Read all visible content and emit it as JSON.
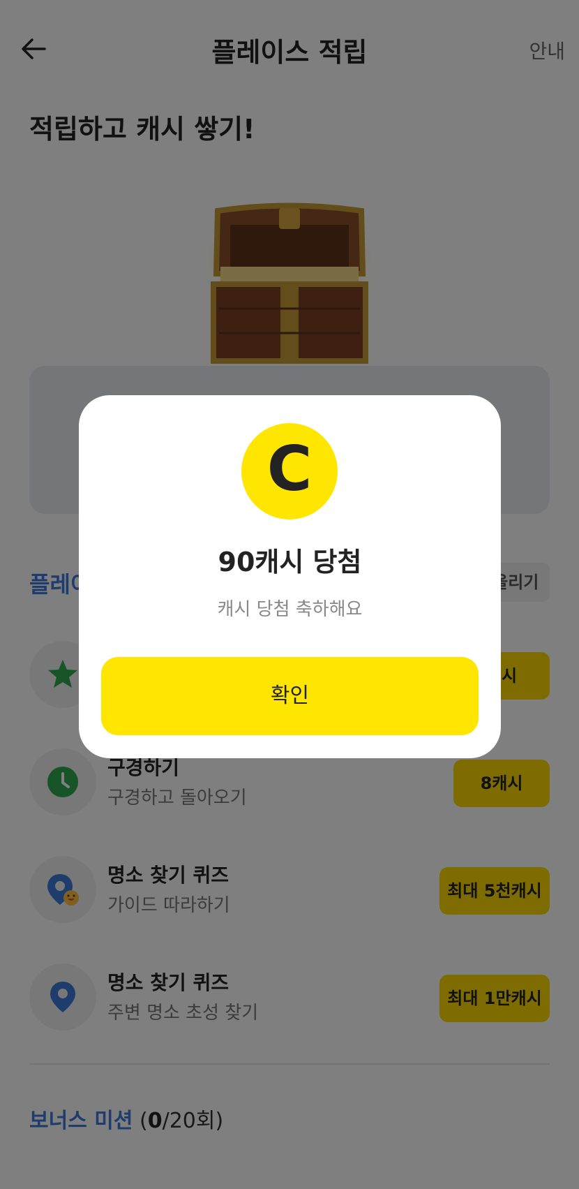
{
  "header": {
    "title": "플레이스 적립",
    "guide_label": "안내"
  },
  "headline": "적립하고 캐시 쌓기!",
  "section": {
    "title": "플레이스 미션",
    "button_label": "알림 올리기"
  },
  "missions": [
    {
      "title": "",
      "subtitle": "",
      "reward": "캐시",
      "icon": "star-icon"
    },
    {
      "title": "구경하기",
      "subtitle": "구경하고 돌아오기",
      "reward": "8캐시",
      "icon": "clock-icon"
    },
    {
      "title": "명소 찾기 퀴즈",
      "subtitle": "가이드 따라하기",
      "reward": "최대 5천캐시",
      "icon": "map-pin-smile-icon"
    },
    {
      "title": "명소 찾기 퀴즈",
      "subtitle": "주변 명소 초성 찾기",
      "reward": "최대 1만캐시",
      "icon": "map-pin-icon"
    }
  ],
  "bonus": {
    "title": "보너스 미션",
    "count_open": "(",
    "current": "0",
    "count_rest": "/20회)"
  },
  "modal": {
    "coin_letter": "C",
    "title": "90캐시 당첨",
    "subtitle": "캐시 당첨 축하해요",
    "confirm_label": "확인"
  },
  "colors": {
    "accent_blue": "#3d78d8",
    "reward_yellow": "#ffd900",
    "confirm_yellow": "#ffe600",
    "overlay": "rgba(0,0,0,0.5)"
  }
}
